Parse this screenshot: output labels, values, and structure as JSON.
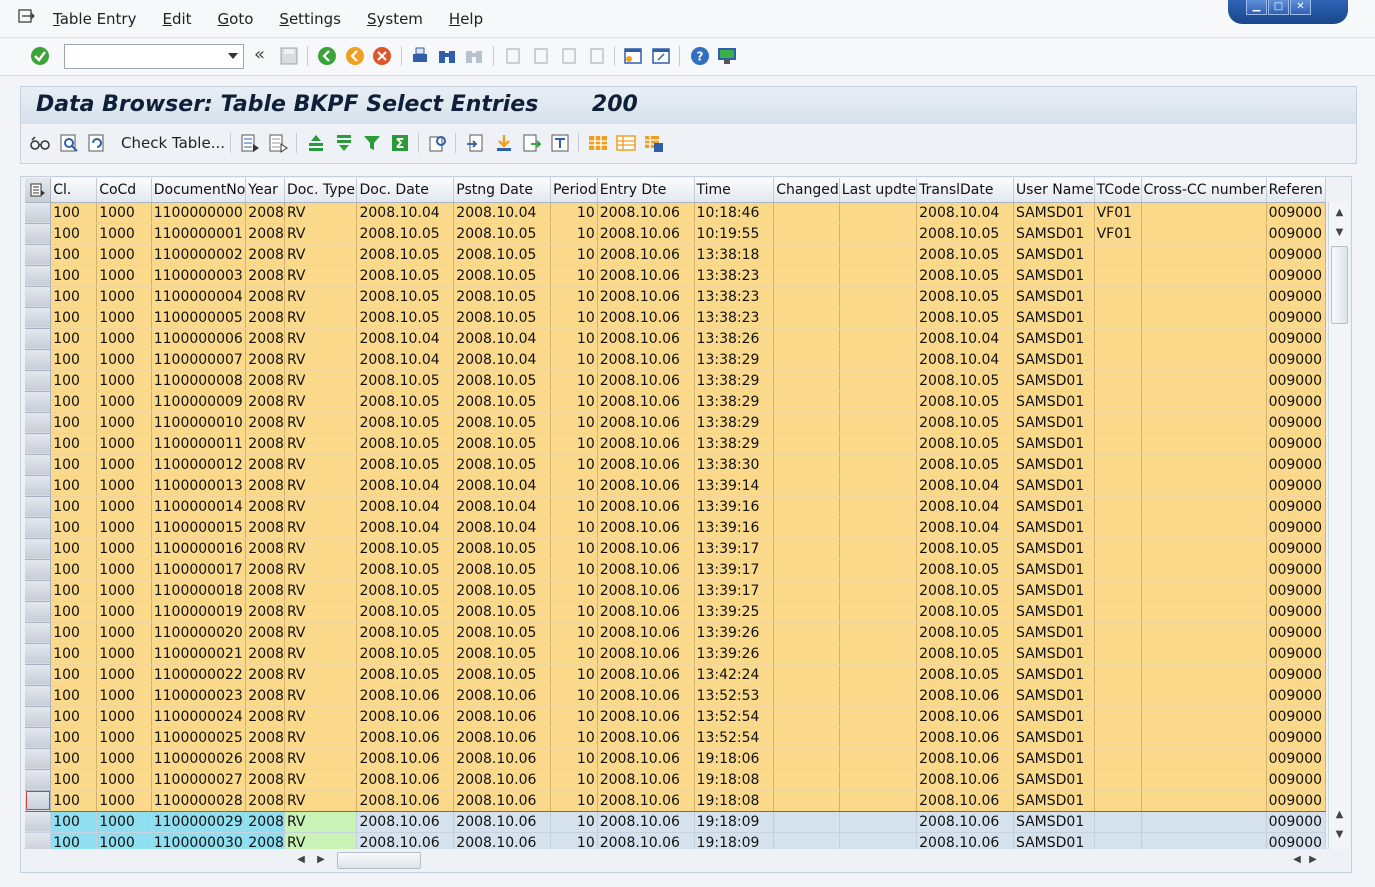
{
  "menu": {
    "items": [
      {
        "label": "Table Entry"
      },
      {
        "label": "Edit"
      },
      {
        "label": "Goto"
      },
      {
        "label": "Settings"
      },
      {
        "label": "System"
      },
      {
        "label": "Help"
      }
    ]
  },
  "command_field": {
    "value": ""
  },
  "title": "Data Browser: Table BKPF Select Entries       200",
  "app_toolbar": {
    "check_table_label": "Check Table..."
  },
  "table": {
    "columns": [
      "Cl.",
      "CoCd",
      "DocumentNo",
      "Year",
      "Doc. Type",
      "Doc. Date",
      "Pstng Date",
      "Period",
      "Entry Dte",
      "Time",
      "Changed",
      "Last updte",
      "TranslDate",
      "User Name",
      "TCode",
      "Cross-CC number",
      "Referen"
    ],
    "rows": [
      [
        "100",
        "1000",
        "1100000000",
        "2008",
        "RV",
        "2008.10.04",
        "2008.10.04",
        "10",
        "2008.10.06",
        "10:18:46",
        "",
        "",
        "2008.10.04",
        "SAMSD01",
        "VF01",
        "",
        "009000"
      ],
      [
        "100",
        "1000",
        "1100000001",
        "2008",
        "RV",
        "2008.10.05",
        "2008.10.05",
        "10",
        "2008.10.06",
        "10:19:55",
        "",
        "",
        "2008.10.05",
        "SAMSD01",
        "VF01",
        "",
        "009000"
      ],
      [
        "100",
        "1000",
        "1100000002",
        "2008",
        "RV",
        "2008.10.05",
        "2008.10.05",
        "10",
        "2008.10.06",
        "13:38:18",
        "",
        "",
        "2008.10.05",
        "SAMSD01",
        "",
        "",
        "009000"
      ],
      [
        "100",
        "1000",
        "1100000003",
        "2008",
        "RV",
        "2008.10.05",
        "2008.10.05",
        "10",
        "2008.10.06",
        "13:38:23",
        "",
        "",
        "2008.10.05",
        "SAMSD01",
        "",
        "",
        "009000"
      ],
      [
        "100",
        "1000",
        "1100000004",
        "2008",
        "RV",
        "2008.10.05",
        "2008.10.05",
        "10",
        "2008.10.06",
        "13:38:23",
        "",
        "",
        "2008.10.05",
        "SAMSD01",
        "",
        "",
        "009000"
      ],
      [
        "100",
        "1000",
        "1100000005",
        "2008",
        "RV",
        "2008.10.05",
        "2008.10.05",
        "10",
        "2008.10.06",
        "13:38:23",
        "",
        "",
        "2008.10.05",
        "SAMSD01",
        "",
        "",
        "009000"
      ],
      [
        "100",
        "1000",
        "1100000006",
        "2008",
        "RV",
        "2008.10.04",
        "2008.10.04",
        "10",
        "2008.10.06",
        "13:38:26",
        "",
        "",
        "2008.10.04",
        "SAMSD01",
        "",
        "",
        "009000"
      ],
      [
        "100",
        "1000",
        "1100000007",
        "2008",
        "RV",
        "2008.10.04",
        "2008.10.04",
        "10",
        "2008.10.06",
        "13:38:29",
        "",
        "",
        "2008.10.04",
        "SAMSD01",
        "",
        "",
        "009000"
      ],
      [
        "100",
        "1000",
        "1100000008",
        "2008",
        "RV",
        "2008.10.05",
        "2008.10.05",
        "10",
        "2008.10.06",
        "13:38:29",
        "",
        "",
        "2008.10.05",
        "SAMSD01",
        "",
        "",
        "009000"
      ],
      [
        "100",
        "1000",
        "1100000009",
        "2008",
        "RV",
        "2008.10.05",
        "2008.10.05",
        "10",
        "2008.10.06",
        "13:38:29",
        "",
        "",
        "2008.10.05",
        "SAMSD01",
        "",
        "",
        "009000"
      ],
      [
        "100",
        "1000",
        "1100000010",
        "2008",
        "RV",
        "2008.10.05",
        "2008.10.05",
        "10",
        "2008.10.06",
        "13:38:29",
        "",
        "",
        "2008.10.05",
        "SAMSD01",
        "",
        "",
        "009000"
      ],
      [
        "100",
        "1000",
        "1100000011",
        "2008",
        "RV",
        "2008.10.05",
        "2008.10.05",
        "10",
        "2008.10.06",
        "13:38:29",
        "",
        "",
        "2008.10.05",
        "SAMSD01",
        "",
        "",
        "009000"
      ],
      [
        "100",
        "1000",
        "1100000012",
        "2008",
        "RV",
        "2008.10.05",
        "2008.10.05",
        "10",
        "2008.10.06",
        "13:38:30",
        "",
        "",
        "2008.10.05",
        "SAMSD01",
        "",
        "",
        "009000"
      ],
      [
        "100",
        "1000",
        "1100000013",
        "2008",
        "RV",
        "2008.10.04",
        "2008.10.04",
        "10",
        "2008.10.06",
        "13:39:14",
        "",
        "",
        "2008.10.04",
        "SAMSD01",
        "",
        "",
        "009000"
      ],
      [
        "100",
        "1000",
        "1100000014",
        "2008",
        "RV",
        "2008.10.04",
        "2008.10.04",
        "10",
        "2008.10.06",
        "13:39:16",
        "",
        "",
        "2008.10.04",
        "SAMSD01",
        "",
        "",
        "009000"
      ],
      [
        "100",
        "1000",
        "1100000015",
        "2008",
        "RV",
        "2008.10.04",
        "2008.10.04",
        "10",
        "2008.10.06",
        "13:39:16",
        "",
        "",
        "2008.10.04",
        "SAMSD01",
        "",
        "",
        "009000"
      ],
      [
        "100",
        "1000",
        "1100000016",
        "2008",
        "RV",
        "2008.10.05",
        "2008.10.05",
        "10",
        "2008.10.06",
        "13:39:17",
        "",
        "",
        "2008.10.05",
        "SAMSD01",
        "",
        "",
        "009000"
      ],
      [
        "100",
        "1000",
        "1100000017",
        "2008",
        "RV",
        "2008.10.05",
        "2008.10.05",
        "10",
        "2008.10.06",
        "13:39:17",
        "",
        "",
        "2008.10.05",
        "SAMSD01",
        "",
        "",
        "009000"
      ],
      [
        "100",
        "1000",
        "1100000018",
        "2008",
        "RV",
        "2008.10.05",
        "2008.10.05",
        "10",
        "2008.10.06",
        "13:39:17",
        "",
        "",
        "2008.10.05",
        "SAMSD01",
        "",
        "",
        "009000"
      ],
      [
        "100",
        "1000",
        "1100000019",
        "2008",
        "RV",
        "2008.10.05",
        "2008.10.05",
        "10",
        "2008.10.06",
        "13:39:25",
        "",
        "",
        "2008.10.05",
        "SAMSD01",
        "",
        "",
        "009000"
      ],
      [
        "100",
        "1000",
        "1100000020",
        "2008",
        "RV",
        "2008.10.05",
        "2008.10.05",
        "10",
        "2008.10.06",
        "13:39:26",
        "",
        "",
        "2008.10.05",
        "SAMSD01",
        "",
        "",
        "009000"
      ],
      [
        "100",
        "1000",
        "1100000021",
        "2008",
        "RV",
        "2008.10.05",
        "2008.10.05",
        "10",
        "2008.10.06",
        "13:39:26",
        "",
        "",
        "2008.10.05",
        "SAMSD01",
        "",
        "",
        "009000"
      ],
      [
        "100",
        "1000",
        "1100000022",
        "2008",
        "RV",
        "2008.10.05",
        "2008.10.05",
        "10",
        "2008.10.06",
        "13:42:24",
        "",
        "",
        "2008.10.05",
        "SAMSD01",
        "",
        "",
        "009000"
      ],
      [
        "100",
        "1000",
        "1100000023",
        "2008",
        "RV",
        "2008.10.06",
        "2008.10.06",
        "10",
        "2008.10.06",
        "13:52:53",
        "",
        "",
        "2008.10.06",
        "SAMSD01",
        "",
        "",
        "009000"
      ],
      [
        "100",
        "1000",
        "1100000024",
        "2008",
        "RV",
        "2008.10.06",
        "2008.10.06",
        "10",
        "2008.10.06",
        "13:52:54",
        "",
        "",
        "2008.10.06",
        "SAMSD01",
        "",
        "",
        "009000"
      ],
      [
        "100",
        "1000",
        "1100000025",
        "2008",
        "RV",
        "2008.10.06",
        "2008.10.06",
        "10",
        "2008.10.06",
        "13:52:54",
        "",
        "",
        "2008.10.06",
        "SAMSD01",
        "",
        "",
        "009000"
      ],
      [
        "100",
        "1000",
        "1100000026",
        "2008",
        "RV",
        "2008.10.06",
        "2008.10.06",
        "10",
        "2008.10.06",
        "19:18:06",
        "",
        "",
        "2008.10.06",
        "SAMSD01",
        "",
        "",
        "009000"
      ],
      [
        "100",
        "1000",
        "1100000027",
        "2008",
        "RV",
        "2008.10.06",
        "2008.10.06",
        "10",
        "2008.10.06",
        "19:18:08",
        "",
        "",
        "2008.10.06",
        "SAMSD01",
        "",
        "",
        "009000"
      ],
      [
        "100",
        "1000",
        "1100000028",
        "2008",
        "RV",
        "2008.10.06",
        "2008.10.06",
        "10",
        "2008.10.06",
        "19:18:08",
        "",
        "",
        "2008.10.06",
        "SAMSD01",
        "",
        "",
        "009000"
      ],
      [
        "100",
        "1000",
        "1100000029",
        "2008",
        "RV",
        "2008.10.06",
        "2008.10.06",
        "10",
        "2008.10.06",
        "19:18:09",
        "",
        "",
        "2008.10.06",
        "SAMSD01",
        "",
        "",
        "009000"
      ],
      [
        "100",
        "1000",
        "1100000030",
        "2008",
        "RV",
        "2008.10.06",
        "2008.10.06",
        "10",
        "2008.10.06",
        "19:18:09",
        "",
        "",
        "2008.10.06",
        "SAMSD01",
        "",
        "",
        "009000"
      ]
    ],
    "key_row_count": 29
  },
  "colors": {
    "key_rows": "#fbd98b",
    "selected_rows": "#d5e2ee",
    "key_highlight": "#8fdff0",
    "doc_type_highlight": "#c9f3b6"
  }
}
